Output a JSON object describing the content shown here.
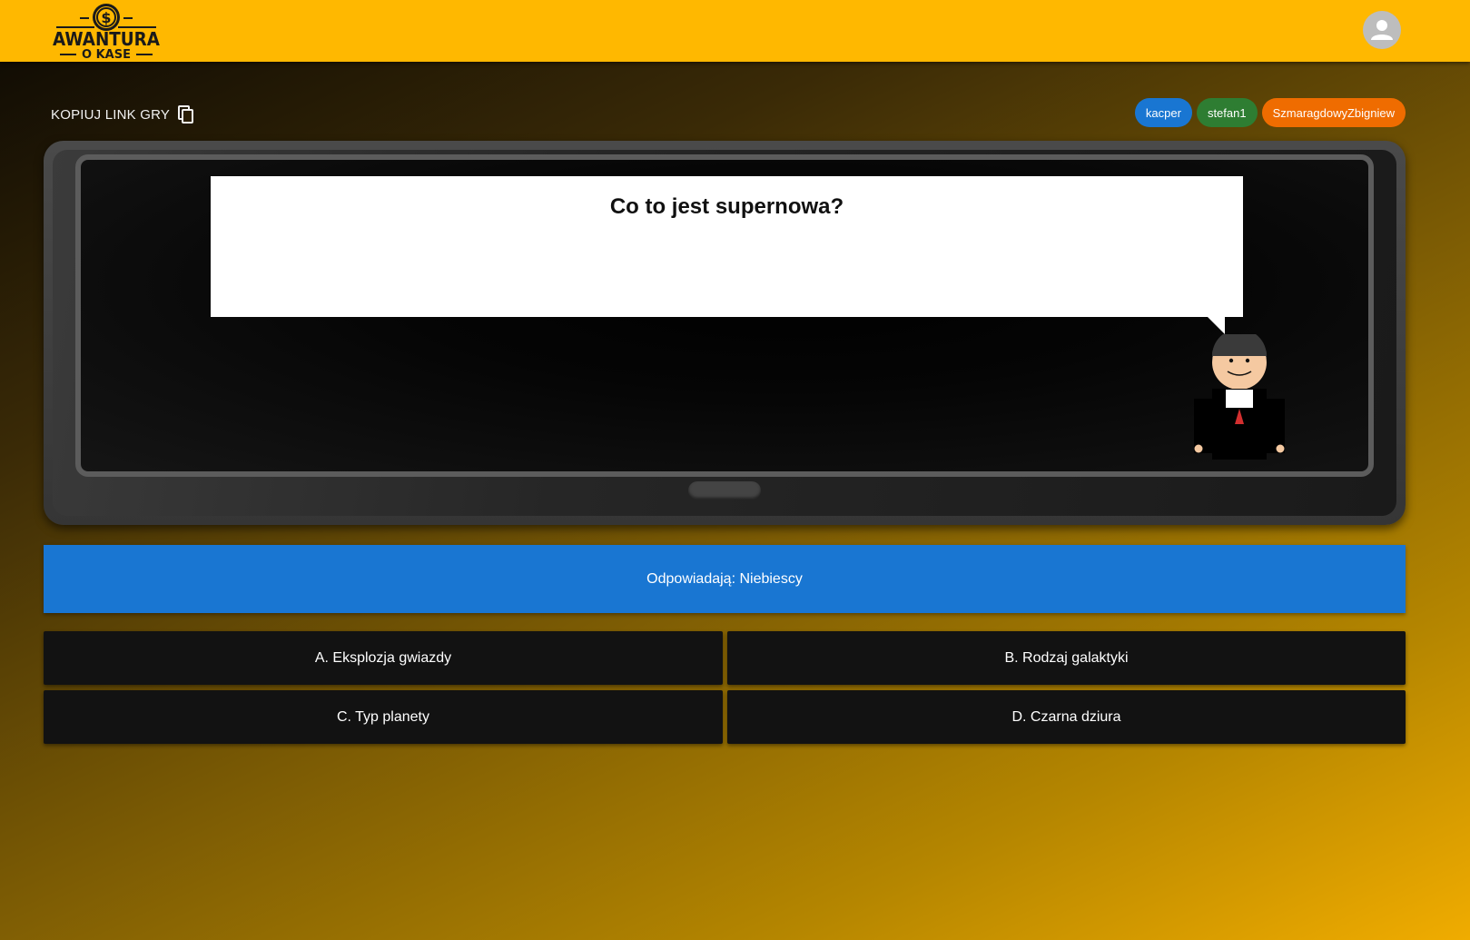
{
  "header": {
    "logo": {
      "line1": "AWANTURA",
      "line2": "O KASE",
      "icon": "dollar-coin-icon"
    },
    "avatar_icon": "person-icon",
    "background_color": "#ffb800"
  },
  "toolbar": {
    "copy_link_label": "KOPIUJ LINK GRY",
    "copy_icon": "copy-icon"
  },
  "players": [
    {
      "name": "kacper",
      "color": "#1976d2"
    },
    {
      "name": "stefan1",
      "color": "#2e7d32"
    },
    {
      "name": "SzmaragdowyZbigniew",
      "color": "#ef6c00"
    }
  ],
  "screen": {
    "question": "Co to jest supernowa?"
  },
  "turn": {
    "label": "Odpowiadają: Niebiescy",
    "color": "#1976d2"
  },
  "answers": [
    {
      "label": "A. Eksplozja gwiazdy"
    },
    {
      "label": "B. Rodzaj galaktyki"
    },
    {
      "label": "C. Typ planety"
    },
    {
      "label": "D. Czarna dziura"
    }
  ]
}
